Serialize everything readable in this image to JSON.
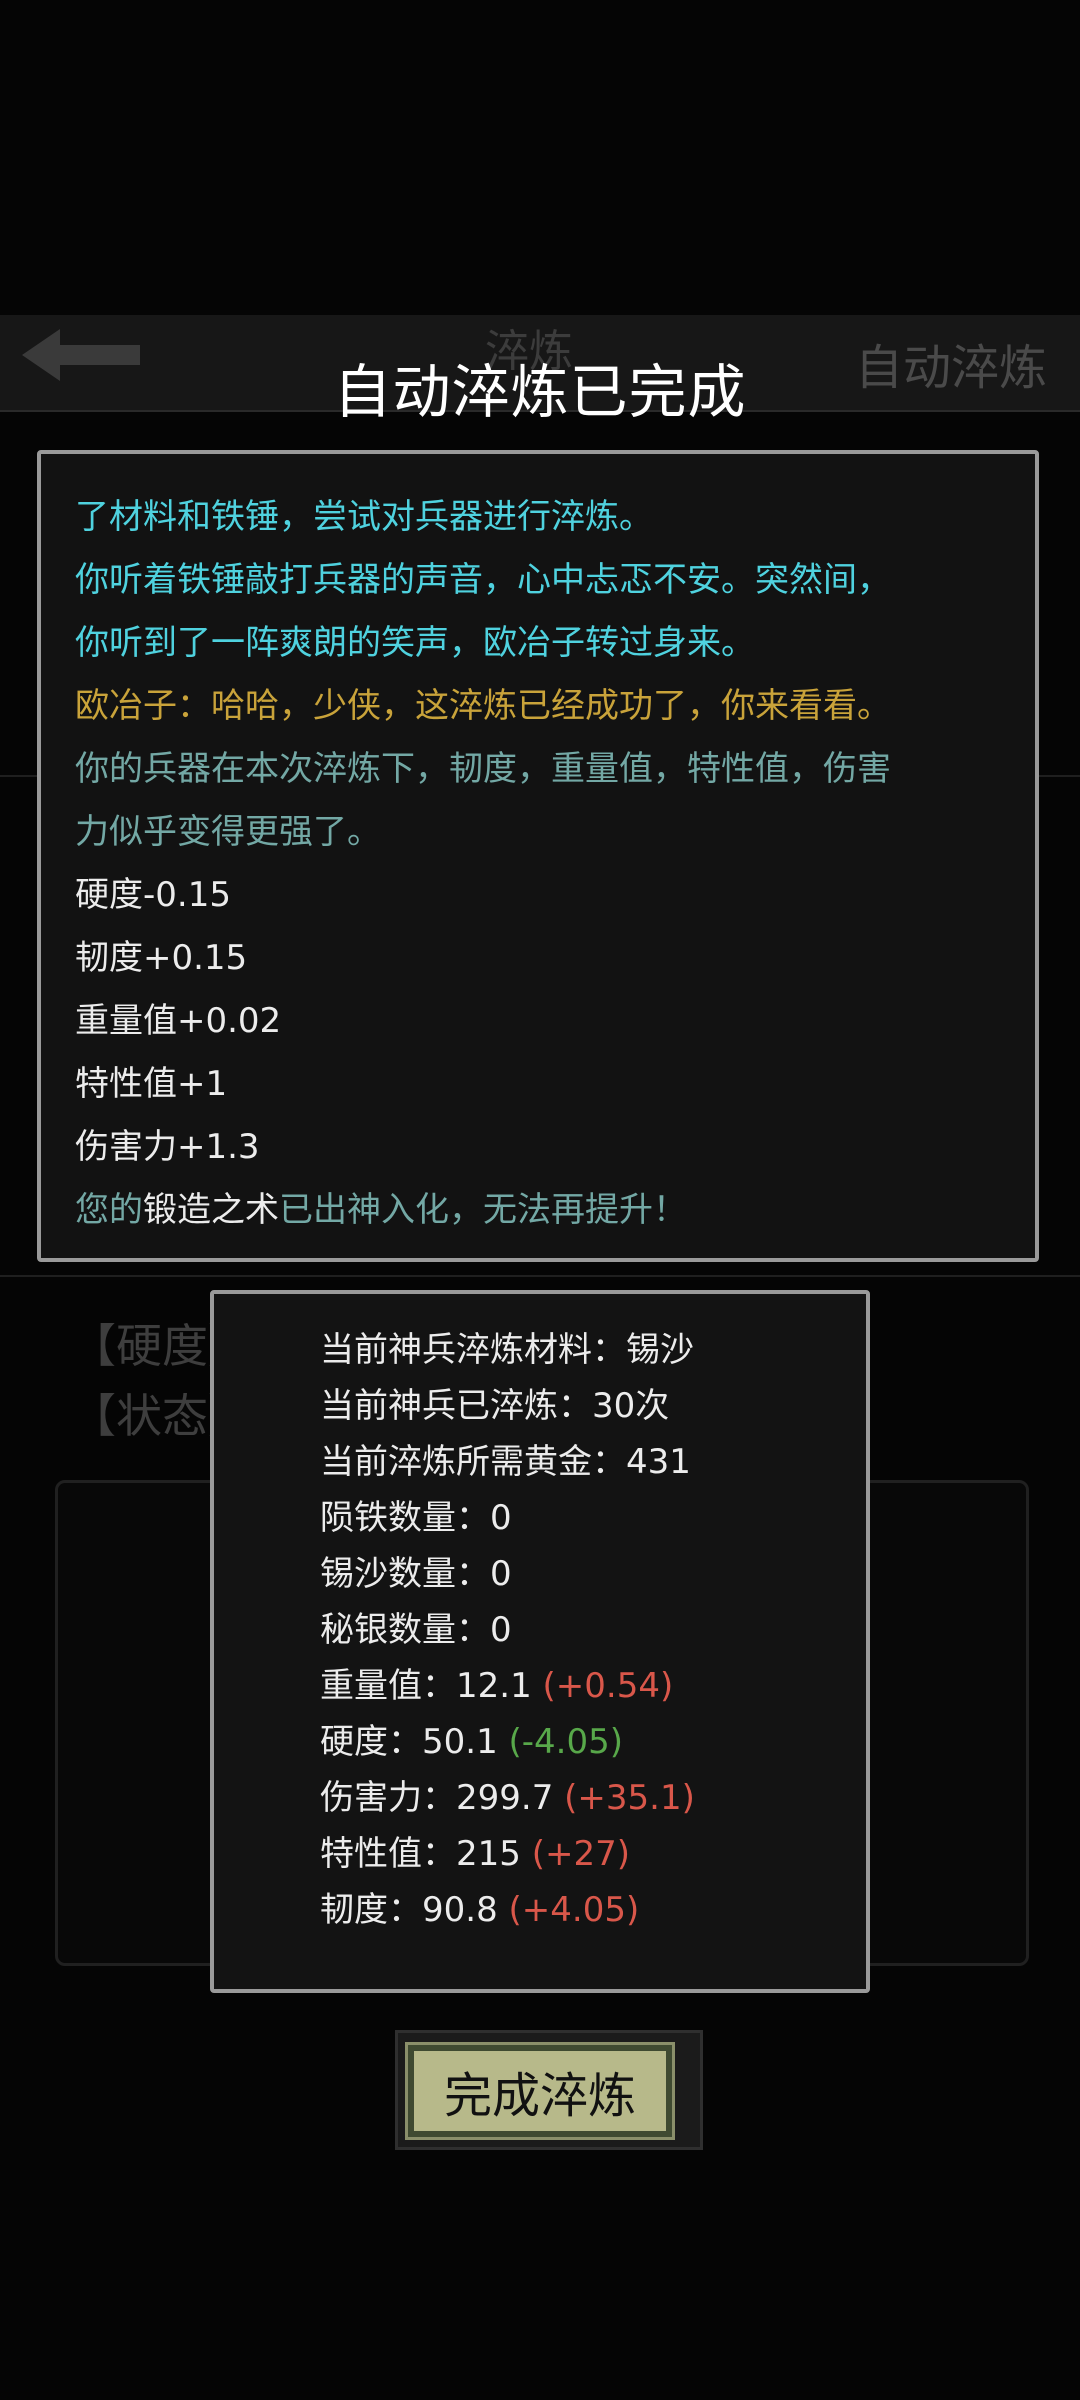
{
  "background": {
    "page_title": "淬炼",
    "auto_button": "自动淬炼",
    "hint_lines": [
      "【硬度】…………击所不摧",
      "【状态】…………轻巧"
    ]
  },
  "modal": {
    "title": "自动淬炼已完成",
    "log_lines": [
      {
        "text": "了材料和铁锤，尝试对兵器进行淬炼。",
        "color": "cyan"
      },
      {
        "text": "你听着铁锤敲打兵器的声音，心中忐忑不安。突然间，",
        "color": "cyan"
      },
      {
        "text": "你听到了一阵爽朗的笑声，欧冶子转过身来。",
        "color": "cyan"
      },
      {
        "text": "欧冶子：哈哈，少侠，这淬炼已经成功了，你来看看。",
        "color": "gold"
      },
      {
        "text": "你的兵器在本次淬炼下，韧度，重量值，特性值，伤害",
        "color": "teal"
      },
      {
        "text": "力似乎变得更强了。",
        "color": "teal"
      },
      {
        "text": "硬度-0.15",
        "color": "white"
      },
      {
        "text": "韧度+0.15",
        "color": "white"
      },
      {
        "text": "重量值+0.02",
        "color": "white"
      },
      {
        "text": "特性值+1",
        "color": "white"
      },
      {
        "text": "伤害力+1.3",
        "color": "white"
      }
    ],
    "final_line": {
      "prefix": "您的",
      "skill": "锻造之术",
      "suffix": "已出神入化，无法再提升！"
    },
    "stats": {
      "material": {
        "label": "当前神兵淬炼材料：",
        "value": "锡沙"
      },
      "refined": {
        "label": "当前神兵已淬炼：",
        "value": "30次"
      },
      "gold": {
        "label": "当前淬炼所需黄金：",
        "value": "431"
      },
      "meteor_iron": {
        "label": "陨铁数量：",
        "value": "0"
      },
      "tin_sand": {
        "label": "锡沙数量：",
        "value": "0"
      },
      "mithril": {
        "label": "秘银数量：",
        "value": "0"
      },
      "weight": {
        "label": "重量值：",
        "value": "12.1",
        "delta": "(+0.54)"
      },
      "hardness": {
        "label": "硬度：",
        "value": "50.1",
        "delta": "(-4.05)"
      },
      "damage": {
        "label": "伤害力：",
        "value": "299.7",
        "delta": "(+35.1)"
      },
      "trait": {
        "label": "特性值：",
        "value": "215",
        "delta": "(+27)"
      },
      "toughness": {
        "label": "韧度：",
        "value": "90.8",
        "delta": "(+4.05)"
      }
    },
    "finish_button": "完成淬炼"
  },
  "colors": {
    "cyan": "#4fd2df",
    "teal": "#73a8a5",
    "gold": "#c9a33a",
    "increase": "#d9574a",
    "decrease": "#58a84a",
    "button_bg": "#b7b98a"
  }
}
